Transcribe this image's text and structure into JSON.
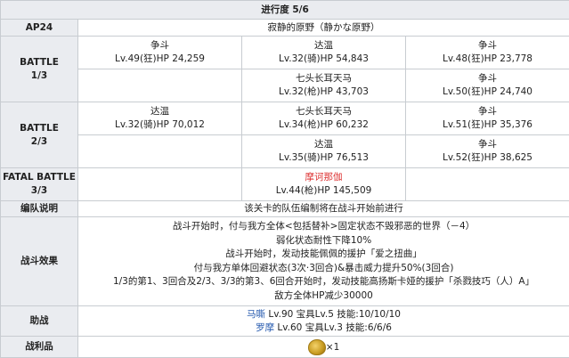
{
  "header": "进行度 5/6",
  "ap": {
    "label": "AP24",
    "name": "寂静的原野（静かな原野）"
  },
  "battle1": {
    "label_top": "BATTLE",
    "label_bottom": "1/3",
    "row1": [
      {
        "name": "争斗",
        "stats": "Lv.49(狂)HP 24,259"
      },
      {
        "name": "达温",
        "stats": "Lv.32(骑)HP 54,843"
      },
      {
        "name": "争斗",
        "stats": "Lv.48(狂)HP 23,778"
      }
    ],
    "row2": [
      {
        "name": "七头长耳天马",
        "stats": "Lv.32(枪)HP 43,703"
      },
      {
        "name": "争斗",
        "stats": "Lv.50(狂)HP 24,740"
      }
    ]
  },
  "battle2": {
    "label_top": "BATTLE",
    "label_bottom": "2/3",
    "row1": [
      {
        "name": "达温",
        "stats": "Lv.32(骑)HP 70,012"
      },
      {
        "name": "七头长耳天马",
        "stats": "Lv.34(枪)HP 60,232"
      },
      {
        "name": "争斗",
        "stats": "Lv.51(狂)HP 35,376"
      }
    ],
    "row2": [
      {
        "name": "达温",
        "stats": "Lv.35(骑)HP 76,513"
      },
      {
        "name": "争斗",
        "stats": "Lv.52(狂)HP 38,625"
      }
    ]
  },
  "battle3": {
    "label_top": "FATAL BATTLE",
    "label_bottom": "3/3",
    "boss": {
      "name": "摩诃那伽",
      "stats": "Lv.44(枪)HP 145,509"
    }
  },
  "formation": {
    "label": "编队说明",
    "text": "该关卡的队伍编制将在战斗开始前进行"
  },
  "effects": {
    "label": "战斗效果",
    "lines": [
      "战斗开始时，付与我方全体<包括替补>固定状态不毁邪恶的世界（－4）",
      "弱化状态耐性下降10%",
      "战斗开始时，发动技能佩佩的援护「爱之扭曲」",
      "付与我方单体回避状态(3次·3回合)&暴击威力提升50%(3回合)",
      "1/3的第1、3回合及2/3、3/3的第3、6回合开始时，发动技能高扬斯卡娅的援护「杀戮技巧（人）A」",
      "敌方全体HP减少30000"
    ]
  },
  "support": {
    "label": "助战",
    "lines": [
      {
        "name": "马嘶",
        "rest": " Lv.90 宝具Lv.5 技能:10/10/10"
      },
      {
        "name": "罗摩",
        "rest": " Lv.60 宝具Lv.3 技能:6/6/6"
      }
    ]
  },
  "reward": {
    "label": "战利品",
    "count": "×1",
    "icon": "gold-fruit-icon"
  },
  "colors": {
    "header_bg": "#eaecf0",
    "border": "#c8ccd1",
    "boss_red": "#d33333",
    "link_blue": "#2a5db0"
  }
}
